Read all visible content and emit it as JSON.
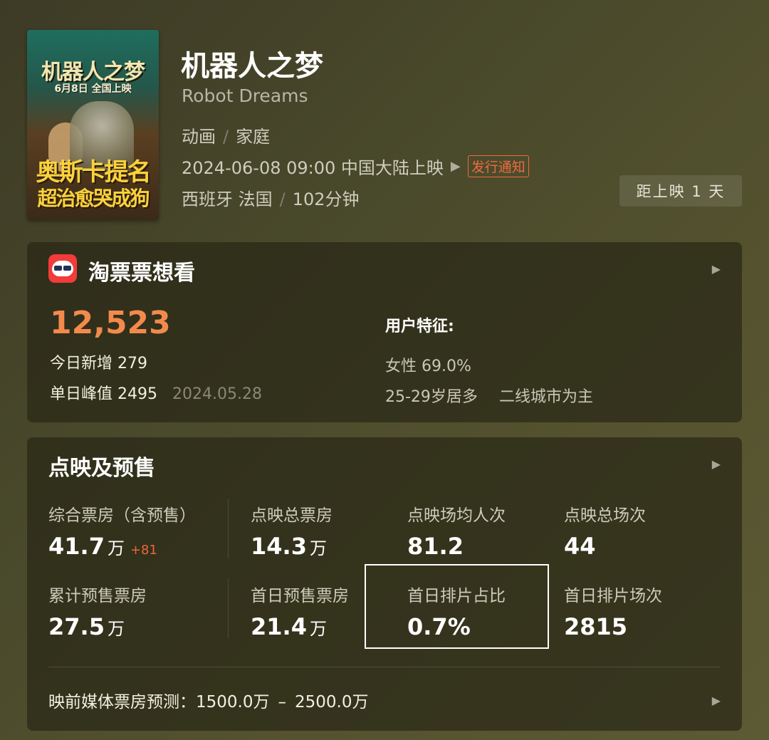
{
  "movie": {
    "poster": {
      "title": "机器人之梦",
      "date": "6月8日 全国上映",
      "line1": "奥斯卡提名",
      "line2": "超治愈哭成狗"
    },
    "title": "机器人之梦",
    "title_en": "Robot Dreams",
    "genres": [
      "动画",
      "家庭"
    ],
    "release": "2024-06-08 09:00 中国大陆上映",
    "notice": "发行通知",
    "countries": "西班牙 法国",
    "duration": "102分钟",
    "countdown": "距上映 1 天"
  },
  "want": {
    "app_name": "淘票票想看",
    "total": "12,523",
    "today_label": "今日新增",
    "today_value": "279",
    "peak_label": "单日峰值",
    "peak_value": "2495",
    "peak_date": "2024.05.28",
    "features_title": "用户特征:",
    "gender": "女性 69.0%",
    "age": "25-29岁居多",
    "city": "二线城市为主"
  },
  "presale": {
    "title": "点映及预售",
    "stats": [
      {
        "label": "综合票房（含预售）",
        "value": "41.7",
        "unit": "万",
        "delta": "+81"
      },
      {
        "label": "点映总票房",
        "value": "14.3",
        "unit": "万"
      },
      {
        "label": "点映场均人次",
        "value": "81.2",
        "unit": ""
      },
      {
        "label": "点映总场次",
        "value": "44",
        "unit": ""
      },
      {
        "label": "累计预售票房",
        "value": "27.5",
        "unit": "万"
      },
      {
        "label": "首日预售票房",
        "value": "21.4",
        "unit": "万"
      },
      {
        "label": "首日排片占比",
        "value": "0.7%",
        "unit": ""
      },
      {
        "label": "首日排片场次",
        "value": "2815",
        "unit": ""
      }
    ],
    "forecast_label": "映前媒体票房预测：",
    "forecast_low": "1500.0万",
    "forecast_sep": "–",
    "forecast_high": "2500.0万"
  },
  "icons": {
    "chevron": "chevron-right-icon",
    "play": "play-icon",
    "app": "taopiaopiao-app-icon"
  },
  "colors": {
    "accent_orange": "#f28a4c",
    "notice_orange": "#ee6b3d",
    "app_red": "#f23b3b"
  }
}
